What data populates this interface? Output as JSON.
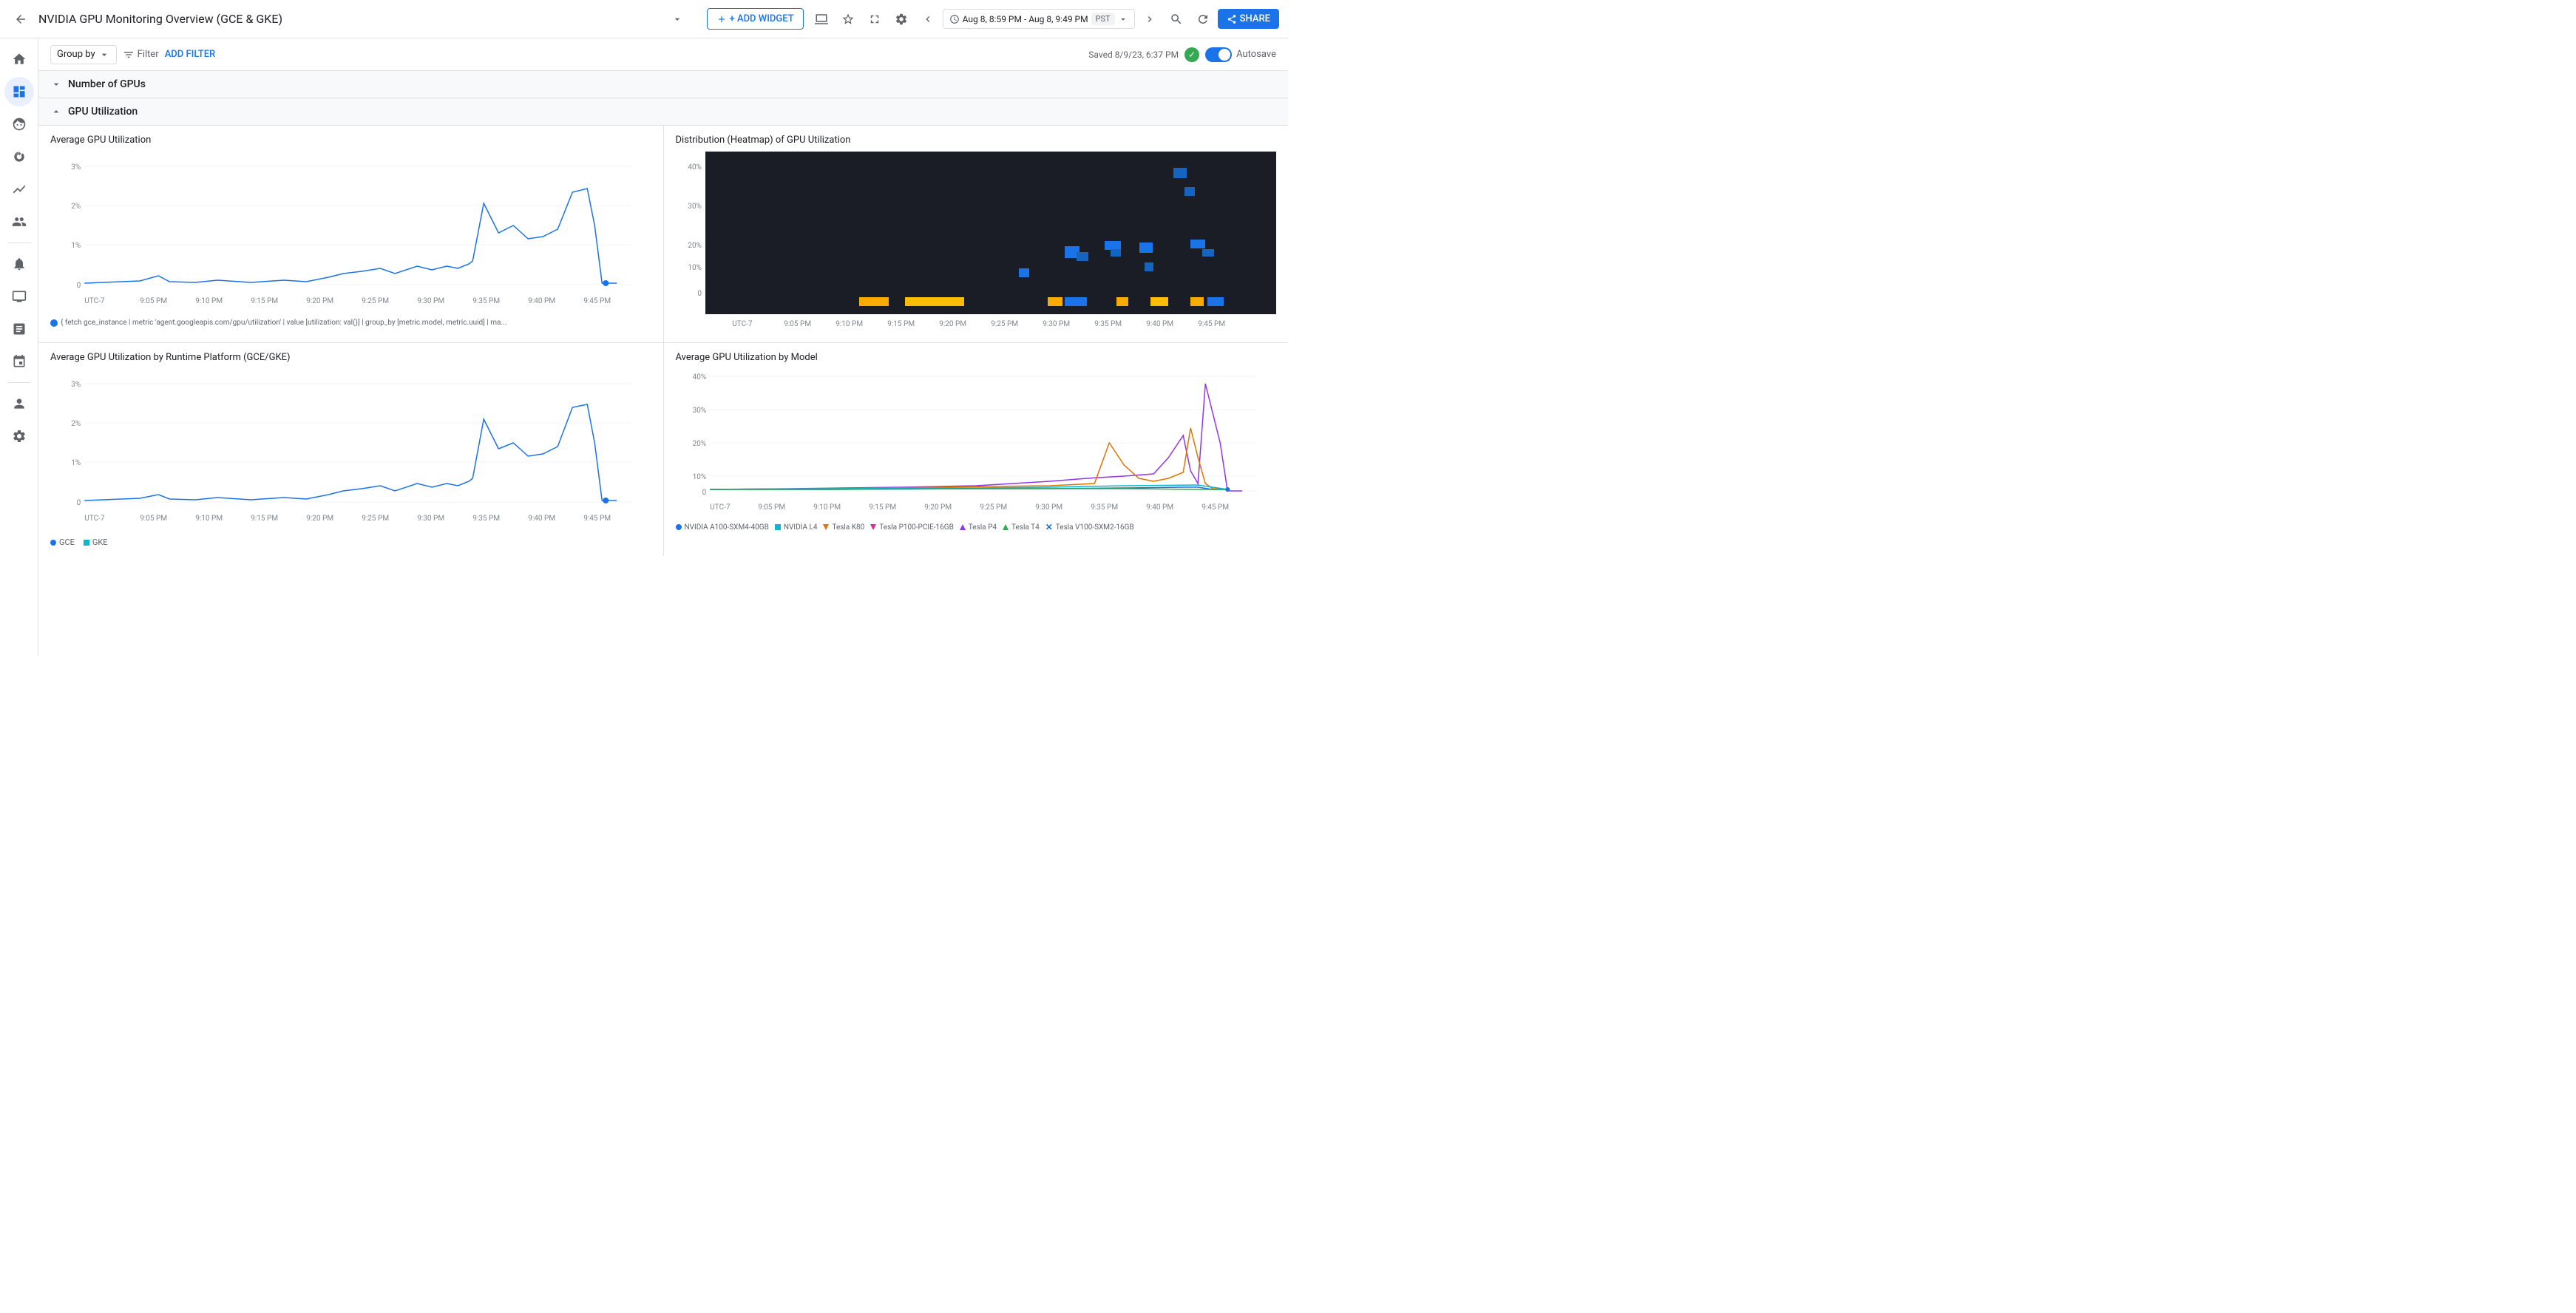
{
  "header": {
    "back_label": "←",
    "title": "NVIDIA GPU Monitoring Overview (GCE & GKE)",
    "title_chevron": "▾",
    "add_widget": "+ ADD WIDGET",
    "present_icon": "▭",
    "star_icon": "☆",
    "fullscreen_icon": "⛶",
    "settings_icon": "⚙",
    "prev_icon": "‹",
    "time_range": "Aug 8, 8:59 PM - Aug 8, 9:49 PM",
    "time_chevron": "▾",
    "tz": "PST",
    "search_icon": "🔍",
    "next_icon": "›",
    "refresh_icon": "⊟",
    "share_label": "SHARE"
  },
  "filter_bar": {
    "group_by": "Group by",
    "filter_icon": "☰",
    "filter_label": "Filter",
    "add_filter": "ADD FILTER",
    "saved_text": "Saved 8/9/23, 6:37 PM",
    "autosave_label": "Autosave"
  },
  "sections": [
    {
      "id": "number-of-gpus",
      "collapsed": true,
      "title": "Number of GPUs",
      "chevron": "▾"
    },
    {
      "id": "gpu-utilization",
      "collapsed": false,
      "title": "GPU Utilization",
      "chevron": "▲"
    }
  ],
  "charts": {
    "avg_gpu_util": {
      "title": "Average GPU Utilization",
      "y_max": "3%",
      "y_mid": "2%",
      "y_low": "1%",
      "y_zero": "0",
      "x_labels": [
        "UTC-7",
        "9:05 PM",
        "9:10 PM",
        "9:15 PM",
        "9:20 PM",
        "9:25 PM",
        "9:30 PM",
        "9:35 PM",
        "9:40 PM",
        "9:45 PM"
      ],
      "query_text": "{ fetch gce_instance | metric 'agent.googleapis.com/gpu/utilization' | value [utilization: val()] | group_by [metric.model, metric.uuid] | ma..."
    },
    "heatmap": {
      "title": "Distribution (Heatmap) of GPU Utilization",
      "y_max": "40%",
      "y_mid1": "30%",
      "y_mid2": "20%",
      "y_mid3": "10%",
      "y_zero": "0",
      "x_labels": [
        "UTC-7",
        "9:05 PM",
        "9:10 PM",
        "9:15 PM",
        "9:20 PM",
        "9:25 PM",
        "9:30 PM",
        "9:35 PM",
        "9:40 PM",
        "9:45 PM"
      ]
    },
    "avg_gpu_runtime": {
      "title": "Average GPU Utilization by Runtime Platform (GCE/GKE)",
      "y_max": "3%",
      "y_mid": "2%",
      "y_low": "1%",
      "y_zero": "0",
      "x_labels": [
        "UTC-7",
        "9:05 PM",
        "9:10 PM",
        "9:15 PM",
        "9:20 PM",
        "9:25 PM",
        "9:30 PM",
        "9:35 PM",
        "9:40 PM",
        "9:45 PM"
      ],
      "legend": [
        {
          "label": "GCE",
          "color": "#1a73e8",
          "shape": "dot"
        },
        {
          "label": "GKE",
          "color": "#12b5cb",
          "shape": "square"
        }
      ]
    },
    "avg_gpu_model": {
      "title": "Average GPU Utilization by Model",
      "y_max": "40%",
      "y_mid1": "30%",
      "y_mid2": "20%",
      "y_mid3": "10%",
      "y_zero": "0",
      "x_labels": [
        "UTC-7",
        "9:05 PM",
        "9:10 PM",
        "9:15 PM",
        "9:20 PM",
        "9:25 PM",
        "9:30 PM",
        "9:35 PM",
        "9:40 PM",
        "9:45 PM"
      ],
      "legend": [
        {
          "label": "NVIDIA A100-SXM4-40GB",
          "color": "#1a73e8",
          "shape": "dot"
        },
        {
          "label": "NVIDIA L4",
          "color": "#12b5cb",
          "shape": "square"
        },
        {
          "label": "Tesla K80",
          "color": "#e37400",
          "shape": "triangle-down"
        },
        {
          "label": "Tesla P100-PCIE-16GB",
          "color": "#e52592",
          "shape": "triangle-down"
        },
        {
          "label": "Tesla P4",
          "color": "#9334e6",
          "shape": "triangle-up"
        },
        {
          "label": "Tesla T4",
          "color": "#34a853",
          "shape": "triangle-up"
        },
        {
          "label": "Tesla V100-SXM2-16GB",
          "color": "#1a73e8",
          "shape": "cross"
        }
      ]
    }
  },
  "sidebar_icons": [
    {
      "name": "home",
      "symbol": "⊞",
      "active": false
    },
    {
      "name": "dashboard",
      "symbol": "⊡",
      "active": true
    },
    {
      "name": "routes",
      "symbol": "→",
      "active": false
    },
    {
      "name": "alerts",
      "symbol": "🔔",
      "active": false
    },
    {
      "name": "chart",
      "symbol": "📊",
      "active": false
    },
    {
      "name": "analytics",
      "symbol": "〜",
      "active": false
    },
    {
      "name": "notifications",
      "symbol": "🔔",
      "active": false
    },
    {
      "name": "monitor",
      "symbol": "🖥",
      "active": false
    },
    {
      "name": "instance",
      "symbol": "⬜",
      "active": false
    },
    {
      "name": "logs",
      "symbol": "☰",
      "active": false
    },
    {
      "name": "person",
      "symbol": "👤",
      "active": false
    },
    {
      "name": "settings",
      "symbol": "⚙",
      "active": false
    }
  ]
}
